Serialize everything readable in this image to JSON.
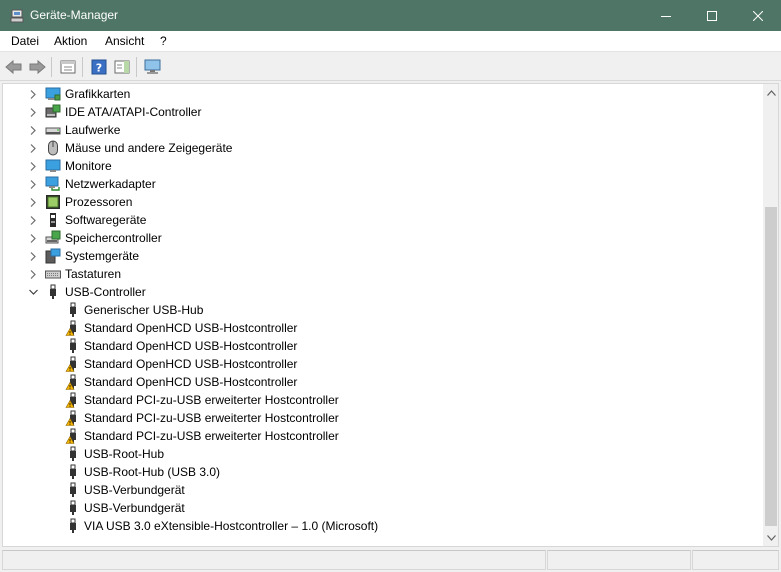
{
  "window": {
    "title": "Geräte-Manager",
    "title_bar_color": "#4f7566"
  },
  "menu": [
    "Datei",
    "Aktion",
    "Ansicht",
    "?"
  ],
  "toolbar": {
    "buttons": [
      "back-icon",
      "forward-icon",
      "properties-pane-icon",
      "help-icon",
      "action-pane-icon",
      "monitor-scan-icon"
    ]
  },
  "tree": {
    "categories": [
      {
        "label": "Grafikkarten",
        "icon": "display-adapter-icon",
        "expanded": false
      },
      {
        "label": "IDE ATA/ATAPI-Controller",
        "icon": "ide-controller-icon",
        "expanded": false
      },
      {
        "label": "Laufwerke",
        "icon": "disk-drive-icon",
        "expanded": false
      },
      {
        "label": "Mäuse und andere Zeigegeräte",
        "icon": "mouse-icon",
        "expanded": false
      },
      {
        "label": "Monitore",
        "icon": "monitor-icon",
        "expanded": false
      },
      {
        "label": "Netzwerkadapter",
        "icon": "network-adapter-icon",
        "expanded": false
      },
      {
        "label": "Prozessoren",
        "icon": "processor-icon",
        "expanded": false
      },
      {
        "label": "Softwaregeräte",
        "icon": "software-device-icon",
        "expanded": false
      },
      {
        "label": "Speichercontroller",
        "icon": "storage-controller-icon",
        "expanded": false
      },
      {
        "label": "Systemgeräte",
        "icon": "system-device-icon",
        "expanded": false
      },
      {
        "label": "Tastaturen",
        "icon": "keyboard-icon",
        "expanded": false
      },
      {
        "label": "USB-Controller",
        "icon": "usb-icon",
        "expanded": true
      }
    ],
    "usb_devices": [
      {
        "label": "Generischer USB-Hub",
        "warning": false
      },
      {
        "label": "Standard OpenHCD USB-Hostcontroller",
        "warning": true
      },
      {
        "label": "Standard OpenHCD USB-Hostcontroller",
        "warning": false
      },
      {
        "label": "Standard OpenHCD USB-Hostcontroller",
        "warning": true
      },
      {
        "label": "Standard OpenHCD USB-Hostcontroller",
        "warning": true
      },
      {
        "label": "Standard PCI-zu-USB erweiterter Hostcontroller",
        "warning": true
      },
      {
        "label": "Standard PCI-zu-USB erweiterter Hostcontroller",
        "warning": true
      },
      {
        "label": "Standard PCI-zu-USB erweiterter Hostcontroller",
        "warning": true
      },
      {
        "label": "USB-Root-Hub",
        "warning": false
      },
      {
        "label": "USB-Root-Hub (USB 3.0)",
        "warning": false
      },
      {
        "label": "USB-Verbundgerät",
        "warning": false
      },
      {
        "label": "USB-Verbundgerät",
        "warning": false
      },
      {
        "label": "VIA USB 3.0 eXtensible-Hostcontroller – 1.0 (Microsoft)",
        "warning": false
      }
    ],
    "warning_color": "#f5b400"
  }
}
